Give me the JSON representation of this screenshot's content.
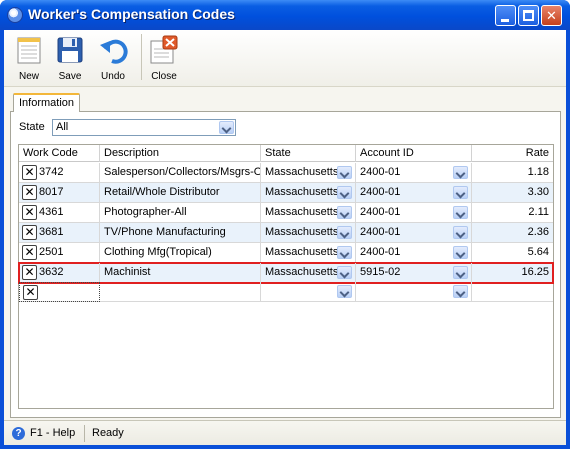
{
  "window": {
    "title": "Worker's Compensation Codes"
  },
  "toolbar": {
    "new_label": "New",
    "save_label": "Save",
    "undo_label": "Undo",
    "close_label": "Close"
  },
  "tabs": {
    "information": "Information"
  },
  "filter": {
    "state_label": "State",
    "state_value": "All"
  },
  "grid": {
    "headers": {
      "work_code": "Work Code",
      "description": "Description",
      "state": "State",
      "account_id": "Account ID",
      "rate": "Rate"
    },
    "rows": [
      {
        "code": "3742",
        "description": "Salesperson/Collectors/Msgrs-Oı",
        "state": "Massachusetts",
        "account": "2400-01",
        "rate": "1.18"
      },
      {
        "code": "8017",
        "description": "Retail/Whole Distributor",
        "state": "Massachusetts",
        "account": "2400-01",
        "rate": "3.30"
      },
      {
        "code": "4361",
        "description": "Photographer-All",
        "state": "Massachusetts",
        "account": "2400-01",
        "rate": "2.11"
      },
      {
        "code": "3681",
        "description": "TV/Phone Manufacturing",
        "state": "Massachusetts",
        "account": "2400-01",
        "rate": "2.36"
      },
      {
        "code": "2501",
        "description": "Clothing Mfg(Tropical)",
        "state": "Massachusetts",
        "account": "2400-01",
        "rate": "5.64"
      },
      {
        "code": "3632",
        "description": "Machinist",
        "state": "Massachusetts",
        "account": "5915-02",
        "rate": "16.25"
      }
    ]
  },
  "status": {
    "help": "F1 - Help",
    "text": "Ready"
  },
  "colors": {
    "title_bar": "#0050dd",
    "highlight": "#e02020",
    "alt_row": "#e9f2fb"
  }
}
